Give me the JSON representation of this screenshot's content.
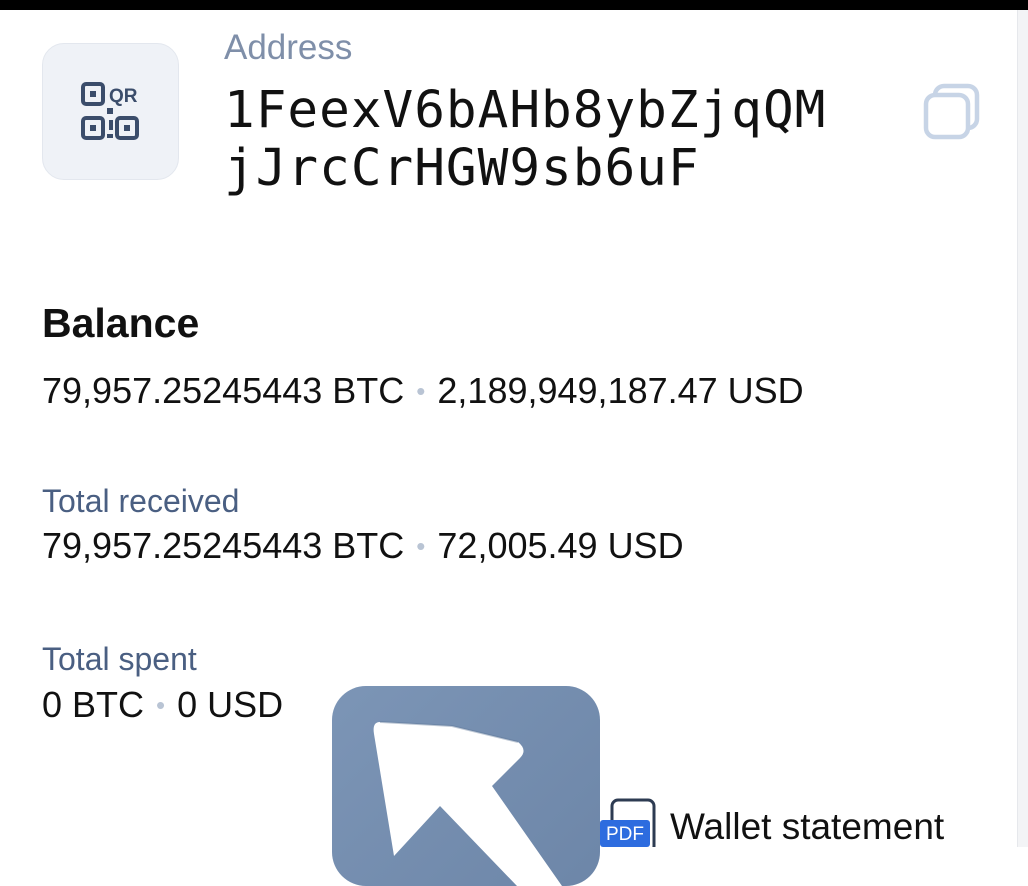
{
  "address": {
    "label": "Address",
    "line1": "1FeexV6bAHb8ybZjqQM",
    "line2": "jJrcCrHGW9sb6uF",
    "qr_icon": "qr-code-icon",
    "copy_icon": "copy-icon"
  },
  "balance": {
    "title": "Balance",
    "btc": "79,957.25245443 BTC",
    "usd": "2,189,949,187.47 USD"
  },
  "received": {
    "label": "Total received",
    "btc": "79,957.25245443 BTC",
    "usd": "72,005.49 USD"
  },
  "spent": {
    "label": "Total spent",
    "btc": "0 BTC",
    "usd": "0 USD"
  },
  "separator": "•",
  "statement": {
    "badge": "PDF",
    "label": "Wallet statement",
    "icon": "pdf-file-icon"
  },
  "colors": {
    "label_gray": "#7f8fa9",
    "label_blue": "#4a5f82",
    "dot": "#b9c4d4",
    "pdf_badge": "#2d6cdf",
    "card": "#7c95b6"
  }
}
